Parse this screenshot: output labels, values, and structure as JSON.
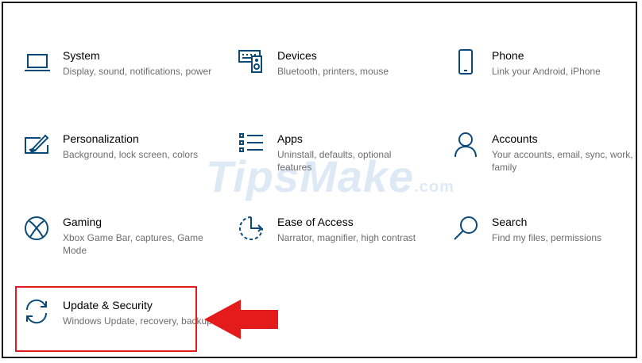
{
  "accent_color": "#0a4a7a",
  "highlight_color": "#e31b1b",
  "watermark": {
    "brand": "TipsMake",
    "suffix": ".com"
  },
  "settings": {
    "system": {
      "title": "System",
      "description": "Display, sound, notifications, power",
      "icon": "laptop-icon"
    },
    "devices": {
      "title": "Devices",
      "description": "Bluetooth, printers, mouse",
      "icon": "devices-icon"
    },
    "phone": {
      "title": "Phone",
      "description": "Link your Android, iPhone",
      "icon": "phone-icon"
    },
    "personalization": {
      "title": "Personalization",
      "description": "Background, lock screen, colors",
      "icon": "paint-brush-icon"
    },
    "apps": {
      "title": "Apps",
      "description": "Uninstall, defaults, optional features",
      "icon": "apps-list-icon"
    },
    "accounts": {
      "title": "Accounts",
      "description": "Your accounts, email, sync, work, family",
      "icon": "person-icon"
    },
    "gaming": {
      "title": "Gaming",
      "description": "Xbox Game Bar, captures, Game Mode",
      "icon": "xbox-icon"
    },
    "ease_of_access": {
      "title": "Ease of Access",
      "description": "Narrator, magnifier, high contrast",
      "icon": "ease-of-access-icon"
    },
    "search": {
      "title": "Search",
      "description": "Find my files, permissions",
      "icon": "search-icon"
    },
    "update_security": {
      "title": "Update & Security",
      "description": "Windows Update, recovery, backup",
      "icon": "sync-icon"
    }
  }
}
